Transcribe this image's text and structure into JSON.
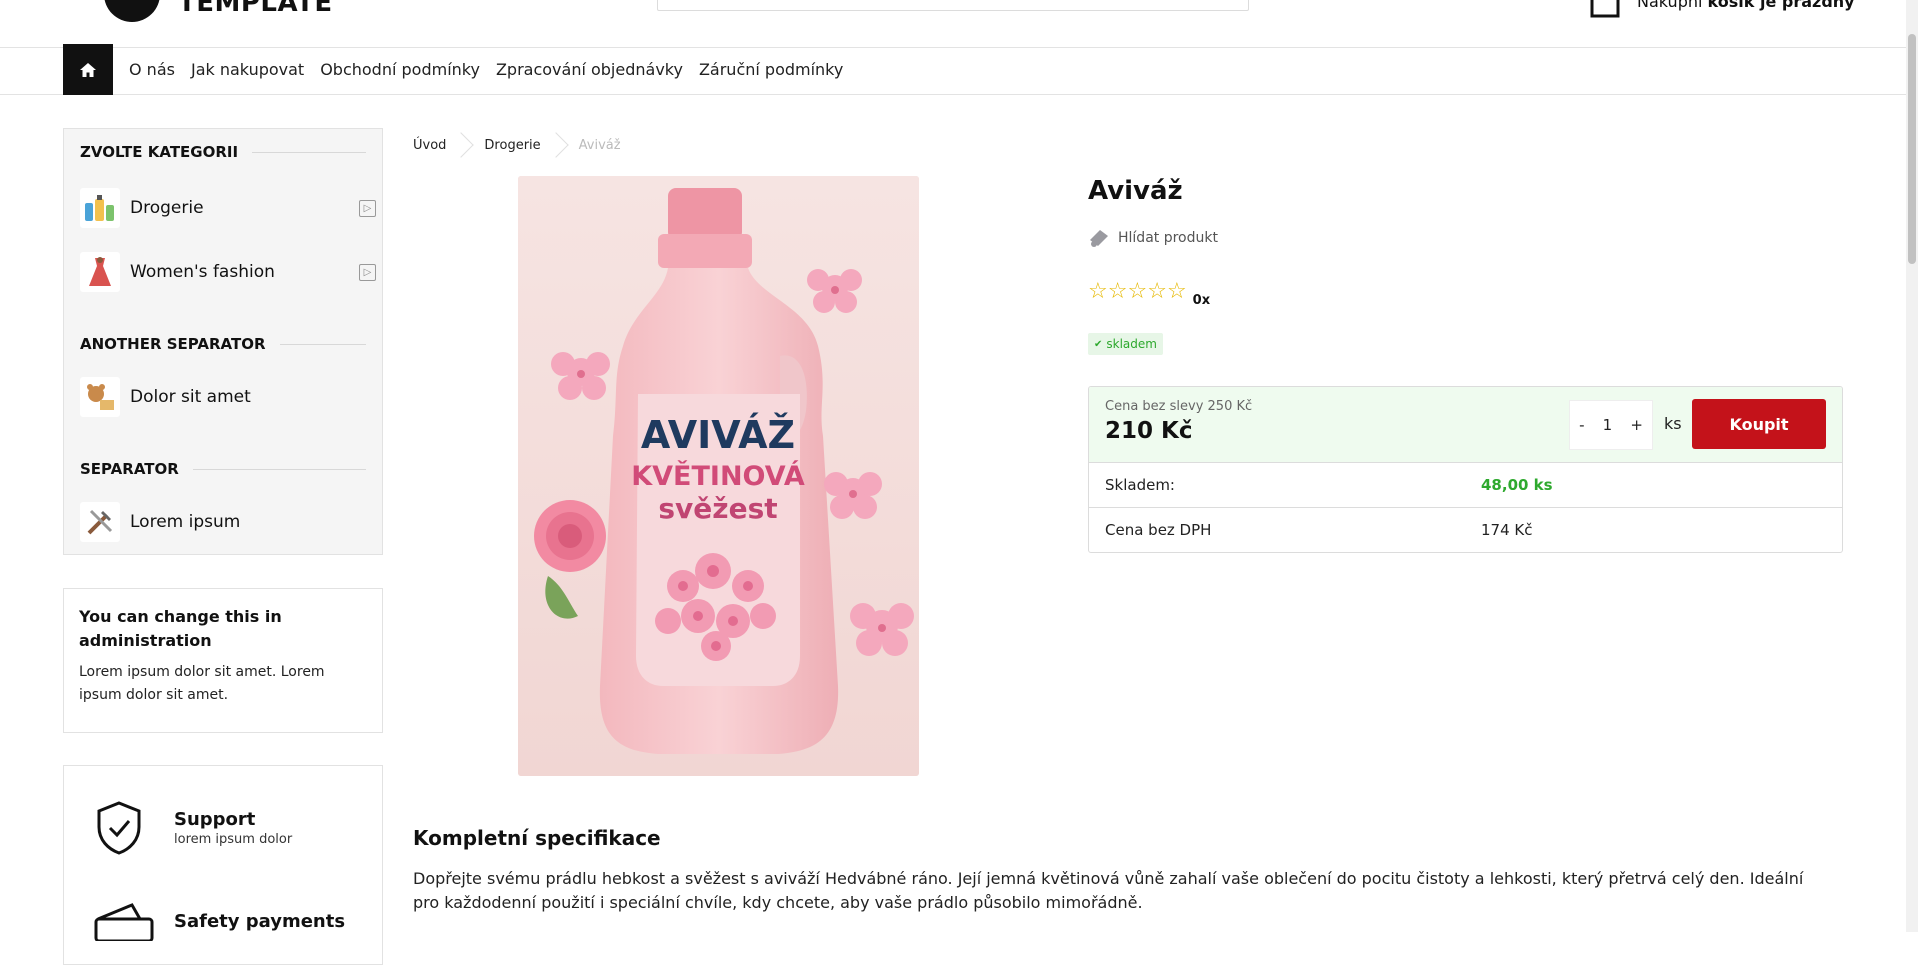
{
  "header": {
    "logo_text": "TEMPLATE",
    "cart_label": "Nákupní",
    "cart_status": "košík je prázdný"
  },
  "nav": {
    "home_icon": "home-icon",
    "links": [
      "O nás",
      "Jak nakupovat",
      "Obchodní podmínky",
      "Zpracování objednávky",
      "Záruční podmínky"
    ]
  },
  "sidebar": {
    "categories_title": "ZVOLTE KATEGORII",
    "categories": [
      {
        "label": "Drogerie"
      },
      {
        "label": "Women's fashion"
      }
    ],
    "separator1": "ANOTHER SEPARATOR",
    "items1": [
      {
        "label": "Dolor sit amet"
      }
    ],
    "separator2": "SEPARATOR",
    "items2": [
      {
        "label": "Lorem ipsum"
      }
    ],
    "info": {
      "title": "You can change this in administration",
      "text": "Lorem ipsum dolor sit amet. Lorem ipsum dolor sit amet."
    },
    "support": [
      {
        "title": "Support",
        "sub": "lorem ipsum dolor"
      },
      {
        "title": "Safety payments",
        "sub": ""
      }
    ]
  },
  "breadcrumb": [
    "Úvod",
    "Drogerie",
    "Aviváž"
  ],
  "product": {
    "title": "Aviváž",
    "watch_label": "Hlídat produkt",
    "rating_count": "0x",
    "rating_value": 0,
    "rating_max": 5,
    "stock_badge": "skladem",
    "image_text": {
      "line1": "AVIVÁŽ",
      "line2": "KVĚTINOVÁ",
      "line3": "svěžest"
    },
    "price_old": "Cena bez slevy 250 Kč",
    "price_new": "210 Kč",
    "qty_minus": "-",
    "qty_value": "1",
    "qty_plus": "+",
    "qty_unit": "ks",
    "buy_label": "Koupit",
    "rows": [
      {
        "key": "Skladem:",
        "value": "48,00 ks"
      },
      {
        "key": "Cena bez DPH",
        "value": "174 Kč"
      }
    ]
  },
  "spec": {
    "title": "Kompletní specifikace",
    "text": "Dopřejte svému prádlu hebkost a svěžest s aviváží Hedvábné ráno. Její jemná květinová vůně zahalí vaše oblečení do pocitu čistoty a lehkosti, který přetrvá celý den. Ideální pro každodenní použití i speciální chvíle, kdy chcete, aby vaše prádlo působilo mimořádně."
  },
  "colors": {
    "accent": "#c4121a",
    "stock_green": "#2ea92e",
    "star": "#e6b800"
  }
}
